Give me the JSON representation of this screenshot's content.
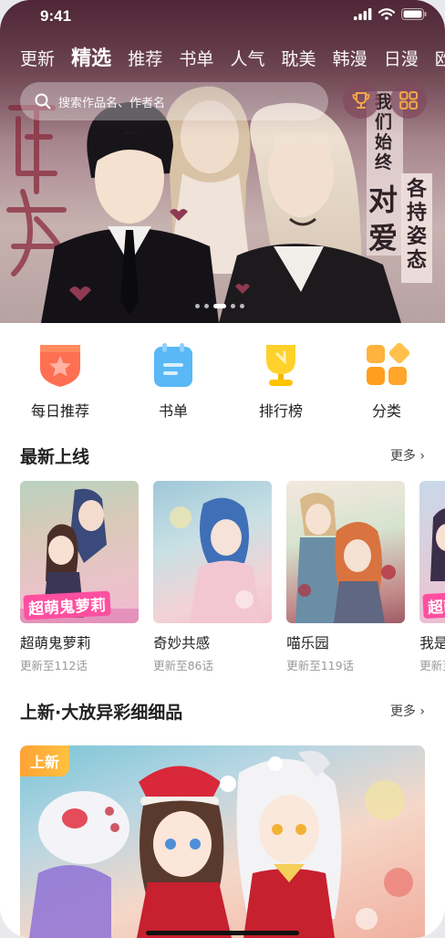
{
  "status_bar": {
    "time": "9:41"
  },
  "nav": {
    "tabs": [
      {
        "label": "更新",
        "active": false
      },
      {
        "label": "精选",
        "active": true
      },
      {
        "label": "推荐",
        "active": false
      },
      {
        "label": "书单",
        "active": false
      },
      {
        "label": "人气",
        "active": false
      },
      {
        "label": "耽美",
        "active": false
      },
      {
        "label": "韩漫",
        "active": false
      },
      {
        "label": "日漫",
        "active": false
      },
      {
        "label": "欧",
        "active": false
      }
    ]
  },
  "search": {
    "placeholder": "搜索作品名、作者名"
  },
  "header_icons": [
    "trophy-icon",
    "grid-icon"
  ],
  "banner": {
    "title_chars": [
      "蝉",
      "女"
    ],
    "slogan_lines": [
      "我们始终",
      "对爱",
      "各持姿态"
    ],
    "carousel": {
      "count": 5,
      "active_index": 2
    }
  },
  "quick_menu": [
    {
      "label": "每日推荐",
      "icon": "star-badge-icon",
      "color": "#ff6f52"
    },
    {
      "label": "书单",
      "icon": "notebook-icon",
      "color": "#59b8f5"
    },
    {
      "label": "排行榜",
      "icon": "trophy-icon",
      "color": "#ffd12a"
    },
    {
      "label": "分类",
      "icon": "category-icon",
      "color": "#ffa62b"
    }
  ],
  "latest": {
    "title": "最新上线",
    "more": "更多 ›",
    "items": [
      {
        "title": "超萌鬼萝莉",
        "update": "更新至112话",
        "overlay": "超萌鬼萝莉"
      },
      {
        "title": "奇妙共感",
        "update": "更新至86话"
      },
      {
        "title": "喵乐园",
        "update": "更新至119话"
      },
      {
        "title": "我是至",
        "update": "更新至",
        "overlay": "超萌"
      }
    ]
  },
  "featured": {
    "title": "上新·大放异彩细细品",
    "more": "更多 ›",
    "badge": "上新"
  }
}
